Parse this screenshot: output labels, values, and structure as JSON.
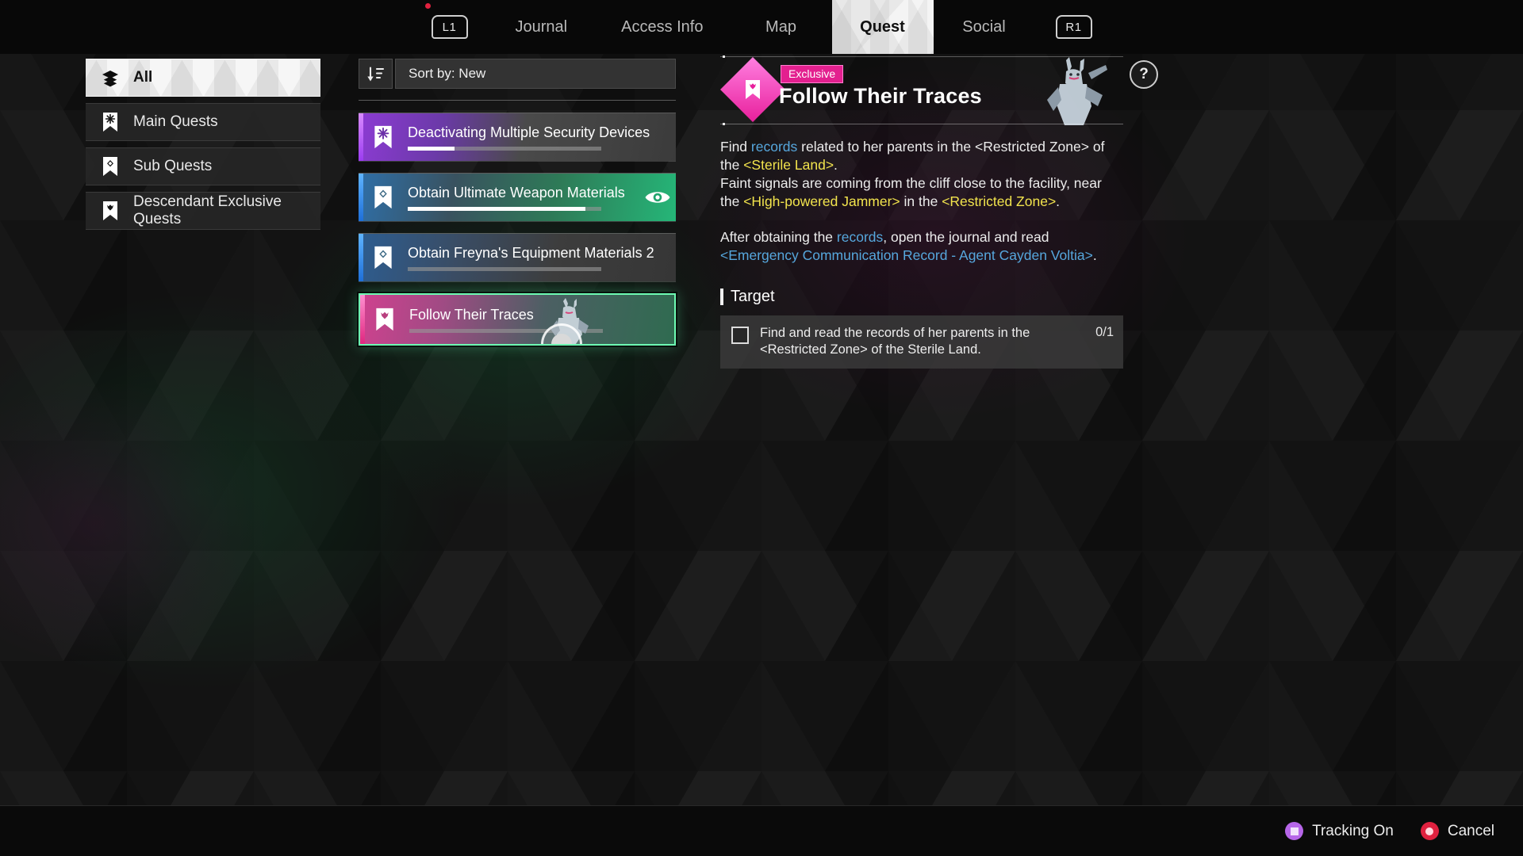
{
  "topnav": {
    "left_bumper": "L1",
    "right_bumper": "R1",
    "tabs": [
      {
        "label": "Journal",
        "active": false,
        "badge": true
      },
      {
        "label": "Access Info",
        "active": false,
        "badge": false
      },
      {
        "label": "Map",
        "active": false,
        "badge": false
      },
      {
        "label": "Quest",
        "active": true,
        "badge": false
      },
      {
        "label": "Social",
        "active": false,
        "badge": false
      }
    ]
  },
  "sidebar": {
    "items": [
      {
        "label": "All",
        "icon": "layers-icon",
        "active": true
      },
      {
        "label": "Main Quests",
        "icon": "bookmark-star-icon",
        "active": false
      },
      {
        "label": "Sub Quests",
        "icon": "bookmark-diamond-icon",
        "active": false
      },
      {
        "label": "Descendant Exclusive Quests",
        "icon": "bookmark-crown-icon",
        "active": false
      }
    ]
  },
  "questlist": {
    "sort_icon": "sort-descending-icon",
    "sort_label": "Sort by: New",
    "items": [
      {
        "title": "Deactivating Multiple Security Devices",
        "icon": "bookmark-star-icon",
        "accent_color": "#c36bff",
        "gradient_from": "#8d3bd4",
        "gradient_to": "#3a3a3a",
        "progress": 24,
        "tracked": false,
        "selected": false
      },
      {
        "title": "Obtain Ultimate Weapon Materials",
        "icon": "bookmark-diamond-icon",
        "accent_color": "#2e8bff",
        "gradient_from": "#2f6fa8",
        "gradient_to": "#1f9d62",
        "progress": 92,
        "tracked": true,
        "tracked_icon": "eye-icon",
        "selected": false
      },
      {
        "title": "Obtain Freyna's Equipment Materials 2",
        "icon": "bookmark-diamond-icon",
        "accent_color": "#2e8bff",
        "gradient_from": "#2d5d91",
        "gradient_to": "#3a3a3a",
        "progress": 0,
        "tracked": false,
        "selected": false
      },
      {
        "title": "Follow Their Traces",
        "icon": "bookmark-crown-icon",
        "accent_color": "#ff4fb0",
        "gradient_from": "#d0418f",
        "gradient_to": "#2f6b50",
        "progress": 0,
        "tracked": false,
        "selected": true
      }
    ]
  },
  "detail": {
    "badge_icon": "bookmark-crown-icon",
    "badge_color": "#e8209c",
    "tag": "Exclusive",
    "title": "Follow Their Traces",
    "character_art": "bunny-character-portrait",
    "description": [
      [
        {
          "t": "Find ",
          "c": "plain"
        },
        {
          "t": "records",
          "c": "blue"
        },
        {
          "t": " related to her parents in the <Restricted Zone> of",
          "c": "plain"
        }
      ],
      [
        {
          "t": "the ",
          "c": "plain"
        },
        {
          "t": "<Sterile Land>",
          "c": "yellow"
        },
        {
          "t": ".",
          "c": "plain"
        }
      ],
      [
        {
          "t": "Faint signals are coming from the cliff close to the facility, near",
          "c": "plain"
        }
      ],
      [
        {
          "t": "the ",
          "c": "plain"
        },
        {
          "t": "<High-powered Jammer>",
          "c": "yellow"
        },
        {
          "t": " in the ",
          "c": "plain"
        },
        {
          "t": "<Restricted Zone>",
          "c": "yellow"
        },
        {
          "t": ".",
          "c": "plain"
        }
      ],
      [
        {
          "t": "",
          "c": "gap"
        }
      ],
      [
        {
          "t": "After obtaining the ",
          "c": "plain"
        },
        {
          "t": "records",
          "c": "blue"
        },
        {
          "t": ", open the journal and read",
          "c": "plain"
        }
      ],
      [
        {
          "t": "<Emergency Communication Record - Agent Cayden Voltia>",
          "c": "blue"
        },
        {
          "t": ".",
          "c": "plain"
        }
      ]
    ],
    "target_heading": "Target",
    "objectives": [
      {
        "text": "Find and read the records of her parents in the <Restricted Zone> of the Sterile Land.",
        "count": "0/1",
        "checked": false
      }
    ],
    "help_label": "?"
  },
  "footer": {
    "buttons": [
      {
        "label": "Tracking On",
        "key": "square-button",
        "color": "#b666e8"
      },
      {
        "label": "Cancel",
        "key": "circle-button",
        "color": "#e0213f"
      }
    ]
  }
}
